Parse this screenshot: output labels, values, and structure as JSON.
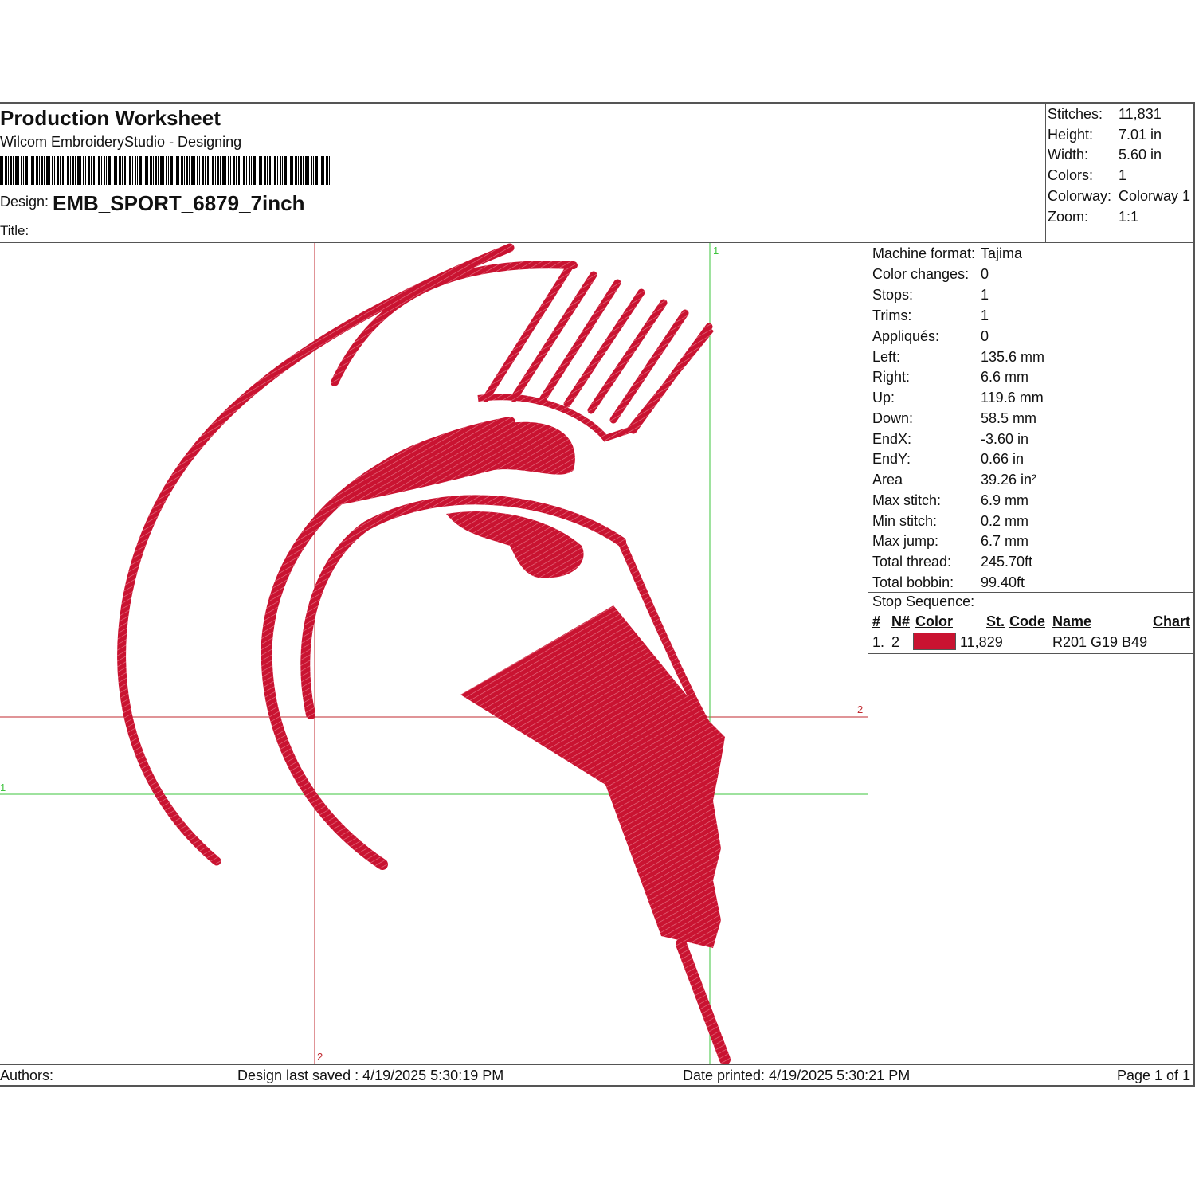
{
  "header": {
    "title": "Production Worksheet",
    "subtitle": "Wilcom EmbroideryStudio - Designing",
    "design_label": "Design:",
    "design_value": "EMB_SPORT_6879_7inch",
    "title_label": "Title:"
  },
  "stats": [
    {
      "key": "Stitches:",
      "value": "11,831"
    },
    {
      "key": "Height:",
      "value": "7.01 in"
    },
    {
      "key": "Width:",
      "value": "5.60 in"
    },
    {
      "key": "Colors:",
      "value": "1"
    },
    {
      "key": "Colorway:",
      "value": "Colorway 1"
    },
    {
      "key": "Zoom:",
      "value": "1:1"
    }
  ],
  "guides": {
    "green_1": "1",
    "red_2_right": "2",
    "green_1_left": "1",
    "red_2_bottom": "2"
  },
  "info": [
    {
      "key": "Machine format:",
      "value": "Tajima"
    },
    {
      "key": "Color changes:",
      "value": "0"
    },
    {
      "key": "Stops:",
      "value": "1"
    },
    {
      "key": "Trims:",
      "value": "1"
    },
    {
      "key": "Appliqués:",
      "value": "0"
    },
    {
      "key": "Left:",
      "value": "135.6 mm"
    },
    {
      "key": "Right:",
      "value": "6.6 mm"
    },
    {
      "key": "Up:",
      "value": "119.6 mm"
    },
    {
      "key": "Down:",
      "value": "58.5 mm"
    },
    {
      "key": "EndX:",
      "value": "-3.60 in"
    },
    {
      "key": "EndY:",
      "value": "0.66 in"
    },
    {
      "key": "Area",
      "value": " 39.26 in²"
    },
    {
      "key": "Max stitch:",
      "value": "6.9 mm"
    },
    {
      "key": "Min stitch:",
      "value": "0.2 mm"
    },
    {
      "key": "Max jump:",
      "value": "6.7 mm"
    },
    {
      "key": "Total thread:",
      "value": "245.70ft"
    },
    {
      "key": "Total bobbin:",
      "value": "99.40ft"
    }
  ],
  "stop_sequence": {
    "title": "Stop Sequence:",
    "headers": {
      "num": "#",
      "n": "N#",
      "color": "Color",
      "st": "St.",
      "code": "Code",
      "name": "Name",
      "chart": "Chart"
    },
    "rows": [
      {
        "num": "1.",
        "n": "2",
        "color_hex": "#c91331",
        "st": "11,829",
        "code": "",
        "name": "R201 G19 B49",
        "chart": ""
      }
    ]
  },
  "footer": {
    "authors": "Authors:",
    "saved": "Design last saved : 4/19/2025 5:30:19 PM",
    "printed": "Date printed: 4/19/2025 5:30:21 PM",
    "page": "Page 1 of 1"
  },
  "colors": {
    "thread": "#c91331",
    "guide_red": "#c0282f",
    "guide_green": "#3ec43e"
  }
}
